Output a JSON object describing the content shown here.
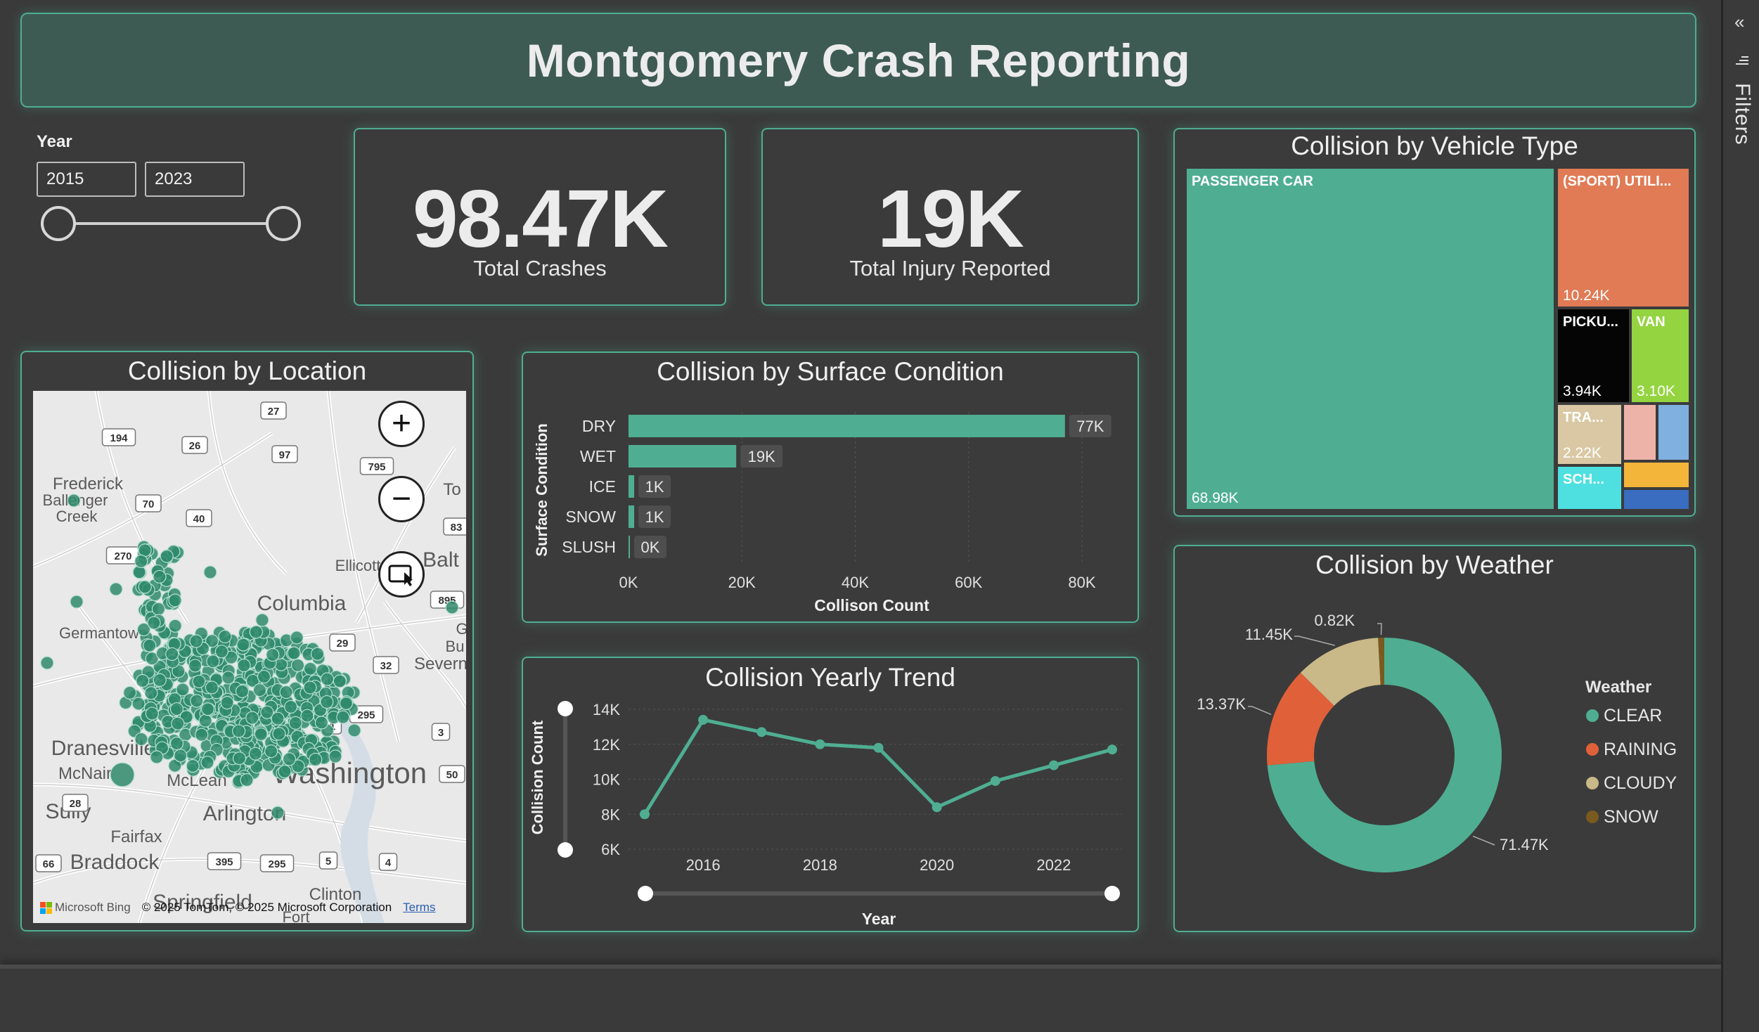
{
  "header": {
    "title": "Montgomery Crash Reporting"
  },
  "year_slicer": {
    "label": "Year",
    "from": "2015",
    "to": "2023"
  },
  "kpis": [
    {
      "value": "98.47K",
      "label": "Total Crashes"
    },
    {
      "value": "19K",
      "label": "Total Injury Reported"
    }
  ],
  "filters_pane": {
    "label": "Filters",
    "collapse_icon": "double-chevron-left-icon",
    "filter_icon": "filter-icon"
  },
  "map": {
    "title": "Collision by Location",
    "zoom_in_label": "+",
    "zoom_out_label": "−",
    "place_labels": [
      "Frederick",
      "Ballenger Creek",
      "Germantown",
      "Columbia",
      "Ellicott City",
      "Baltimore",
      "Severn",
      "Dranesville",
      "McNair",
      "McLean",
      "Washington",
      "Sully",
      "Fairfax",
      "Arlington",
      "Braddock",
      "Springfield",
      "Clinton",
      "Fort",
      "Towson",
      "Glen Burnie"
    ],
    "route_shields": [
      "194",
      "27",
      "26",
      "97",
      "795",
      "70",
      "40",
      "83",
      "270",
      "895",
      "29",
      "32",
      "295",
      "1",
      "3",
      "50",
      "28",
      "395",
      "295",
      "5",
      "4",
      "66"
    ],
    "attribution": "© 2025 TomTom, © 2025 Microsoft Corporation",
    "terms_label": "Terms",
    "provider": "Microsoft Bing",
    "marker_color": "#2f8a6c"
  },
  "chart_data": [
    {
      "type": "treemap",
      "title": "Collision by Vehicle Type",
      "items": [
        {
          "label": "PASSENGER CAR",
          "value": 68.98,
          "display": "68.98K",
          "color": "#4fae92"
        },
        {
          "label": "(SPORT) UTILI...",
          "value": 10.24,
          "display": "10.24K",
          "color": "#e07b55"
        },
        {
          "label": "PICKU...",
          "value": 3.94,
          "display": "3.94K",
          "color": "#050505"
        },
        {
          "label": "VAN",
          "value": 3.1,
          "display": "3.10K",
          "color": "#94d440"
        },
        {
          "label": "TRA...",
          "value": 2.22,
          "display": "2.22K",
          "color": "#d9c8a3"
        },
        {
          "label": "SCH...",
          "value": null,
          "display": "",
          "color": "#4ee0e0"
        },
        {
          "label": "",
          "value": null,
          "display": "",
          "color": "#eeb3a8"
        },
        {
          "label": "",
          "value": null,
          "display": "",
          "color": "#7fb0e0"
        },
        {
          "label": "",
          "value": null,
          "display": "",
          "color": "#f3b53a"
        },
        {
          "label": "",
          "value": null,
          "display": "",
          "color": "#3a6cc0"
        }
      ]
    },
    {
      "type": "bar",
      "orientation": "horizontal",
      "title": "Collision by Surface Condition",
      "ylabel": "Surface Condition",
      "xlabel": "Collison Count",
      "categories": [
        "DRY",
        "WET",
        "ICE",
        "SNOW",
        "SLUSH"
      ],
      "values": [
        77000,
        19000,
        1000,
        1000,
        0
      ],
      "data_labels": [
        "77K",
        "19K",
        "1K",
        "1K",
        "0K"
      ],
      "xticks": [
        "0K",
        "20K",
        "40K",
        "60K",
        "80K"
      ],
      "xlim": [
        0,
        80000
      ],
      "color": "#4fae92"
    },
    {
      "type": "line",
      "title": "Collision Yearly Trend",
      "xlabel": "Year",
      "ylabel": "Collision Count",
      "x": [
        2015,
        2016,
        2017,
        2018,
        2019,
        2020,
        2021,
        2022,
        2023
      ],
      "values": [
        8000,
        13400,
        12700,
        12000,
        11800,
        8400,
        9900,
        10800,
        11700
      ],
      "xticks": [
        "2016",
        "2018",
        "2020",
        "2022"
      ],
      "yticks": [
        "6K",
        "8K",
        "10K",
        "12K",
        "14K"
      ],
      "ylim": [
        6000,
        14000
      ],
      "color": "#4fae92"
    },
    {
      "type": "pie",
      "donut": true,
      "title": "Collision by Weather",
      "legend_title": "Weather",
      "legend_position": "right",
      "labels": [
        "CLEAR",
        "RAINING",
        "CLOUDY",
        "SNOW"
      ],
      "values": [
        71.47,
        13.37,
        11.45,
        0.82
      ],
      "data_labels": [
        "71.47K",
        "13.37K",
        "11.45K",
        "0.82K"
      ],
      "colors": [
        "#4fae92",
        "#e0603a",
        "#c9b888",
        "#7a5a1e"
      ]
    }
  ]
}
